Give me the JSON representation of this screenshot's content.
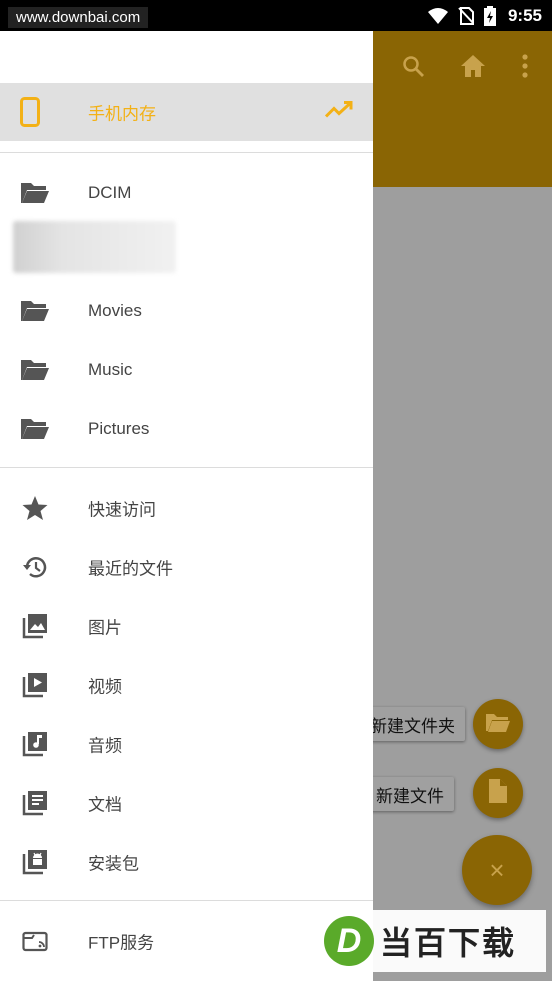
{
  "watermark_top": "www.downbai.com",
  "watermark_bottom": {
    "logo_letter": "D",
    "text": "当百下载"
  },
  "status": {
    "time": "9:55",
    "icons": [
      "wifi-icon",
      "no-sim-icon",
      "battery-charging-icon"
    ]
  },
  "toolbar": {
    "icons": [
      "search-icon",
      "home-icon",
      "more-vert-icon"
    ]
  },
  "colors": {
    "accent": "#f3b116",
    "toolbar_dimmed": "#8a6504",
    "scrim": "#9e9e9e"
  },
  "drawer": {
    "storage": {
      "label": "手机内存",
      "icon": "phone-icon",
      "trailing_icon": "trending-icon"
    },
    "folders": [
      {
        "label": "DCIM",
        "icon": "folder-icon"
      },
      {
        "label": "Movies",
        "icon": "folder-icon"
      },
      {
        "label": "Music",
        "icon": "folder-icon"
      },
      {
        "label": "Pictures",
        "icon": "folder-icon"
      }
    ],
    "categories": [
      {
        "label": "快速访问",
        "icon": "star-icon"
      },
      {
        "label": "最近的文件",
        "icon": "history-icon"
      },
      {
        "label": "图片",
        "icon": "image-icon"
      },
      {
        "label": "视频",
        "icon": "video-icon"
      },
      {
        "label": "音频",
        "icon": "audio-icon"
      },
      {
        "label": "文档",
        "icon": "document-icon"
      },
      {
        "label": "安装包",
        "icon": "android-icon"
      }
    ],
    "ftp": {
      "label": "FTP服务",
      "icon": "ftp-icon"
    }
  },
  "fab_menu": {
    "new_folder": "新建文件夹",
    "new_file": "新建文件",
    "close": "×"
  }
}
